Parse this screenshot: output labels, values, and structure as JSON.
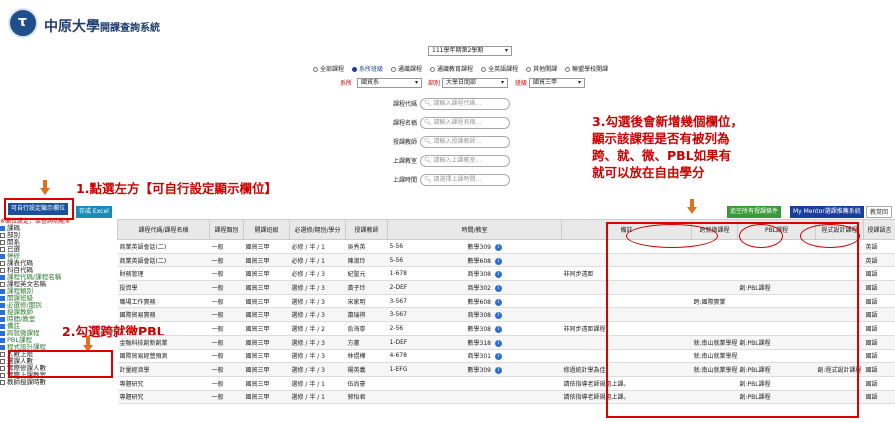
{
  "site": {
    "title_main": "中原大學",
    "title_sub": "開課查詢系統",
    "logo_glyph": "τ"
  },
  "semester": "111學年期第2學期",
  "radios": [
    {
      "label": "全部課程",
      "on": false
    },
    {
      "label": "系所班級",
      "on": true
    },
    {
      "label": "通識課程",
      "on": false
    },
    {
      "label": "通識教育課程",
      "on": false
    },
    {
      "label": "全英語課程",
      "on": false
    },
    {
      "label": "其他開課",
      "on": false
    },
    {
      "label": "聯盟學校開課",
      "on": false
    }
  ],
  "filters": {
    "dept_label": "系所",
    "dept_value": "國貿系",
    "college_label": "部別",
    "college_value": "大學日間部",
    "class_label": "班級",
    "class_value": "國貿三甲"
  },
  "search_fields": [
    {
      "label": "課程代碼",
      "placeholder": "請輸入課程代碼..."
    },
    {
      "label": "課程名稱",
      "placeholder": "請輸入課程名稱..."
    },
    {
      "label": "授課教師",
      "placeholder": "請輸入授課教師..."
    },
    {
      "label": "上課教室",
      "placeholder": "請輸入上課教室..."
    },
    {
      "label": "上課時間",
      "placeholder": "請選擇上課時間..."
    }
  ],
  "annotations": {
    "a1": "1.點選左方【可自行設定顯示欄位】",
    "a2": "2.勾選跨就微PBL",
    "a3_l1": "3.勾選後會新增幾個欄位，",
    "a3_l2": "顯示該課程是否有被列為",
    "a3_l3": "跨、就、微、PBL如果有",
    "a3_l4": "就可以放在自由學分"
  },
  "buttons": {
    "col_setting": "可自行設定顯示欄位",
    "excel": "存成 Excel",
    "add_all": "追空所有授課條件",
    "mentor": "My Mentor選課推薦系統",
    "right_cut": "教覚回"
  },
  "left_note": "※欄位設定，本查詢功能※",
  "left_items": [
    {
      "label": "課碼",
      "on": true,
      "green": false
    },
    {
      "label": "部別",
      "on": false,
      "green": false
    },
    {
      "label": "開系",
      "on": false,
      "green": false
    },
    {
      "label": "已選",
      "on": false,
      "green": false
    },
    {
      "label": "停修",
      "on": true,
      "green": true
    },
    {
      "label": "課表代碼",
      "on": false,
      "green": false
    },
    {
      "label": "科目代碼",
      "on": false,
      "green": false
    },
    {
      "label": "課程代碼/課程名稱",
      "on": true,
      "green": true
    },
    {
      "label": "課程英文名稱",
      "on": false,
      "green": false
    },
    {
      "label": "課程類別",
      "on": true,
      "green": true
    },
    {
      "label": "開課班級",
      "on": true,
      "green": true
    },
    {
      "label": "必選修/期別",
      "on": true,
      "green": true
    },
    {
      "label": "授課教師",
      "on": true,
      "green": true
    },
    {
      "label": "時間/教室",
      "on": true,
      "green": true
    },
    {
      "label": "備註",
      "on": true,
      "green": true
    },
    {
      "label": "跨就微課程",
      "on": true,
      "green": true
    },
    {
      "label": "PBL課程",
      "on": true,
      "green": true
    },
    {
      "label": "程式設計課程",
      "on": true,
      "green": true
    },
    {
      "label": "人數上限",
      "on": false,
      "green": false
    },
    {
      "label": "選課人數",
      "on": false,
      "green": false
    },
    {
      "label": "實際修課人數",
      "on": false,
      "green": false
    },
    {
      "label": "實際上課教室",
      "on": false,
      "green": false
    },
    {
      "label": "教師授課時數",
      "on": false,
      "green": false
    }
  ],
  "table": {
    "headers": [
      "課程代碼/課程名稱",
      "課程類別",
      "開課班級",
      "必選修/期別/學分",
      "授課教師",
      "時間/教室",
      "備註",
      "跨就微課程",
      "PBL課程",
      "程式設計課程",
      "授課語言"
    ],
    "rows": [
      [
        "商業英語會話(二)",
        "一般",
        "國貿三甲",
        "必修 / 半 / 1",
        "吳秀英",
        "5-56",
        "數學309",
        "",
        "",
        "",
        "",
        "英語"
      ],
      [
        "商業英語會話(二)",
        "一般",
        "國貿三甲",
        "必修 / 半 / 1",
        "陳淑玲",
        "5-56",
        "數學608",
        "",
        "",
        "",
        "",
        "英語"
      ],
      [
        "財務管理",
        "一般",
        "國貿三甲",
        "必修 / 半 / 3",
        "紀聖元",
        "1-678",
        "商學308",
        "非同步遠距",
        "",
        "",
        "",
        "國語"
      ],
      [
        "投資學",
        "一般",
        "國貿三甲",
        "選修 / 半 / 3",
        "黃子玲",
        "2-DEF",
        "商學302",
        "",
        "",
        "創:PBL課程",
        "",
        "國語"
      ],
      [
        "職場工作實務",
        "一般",
        "國貿三甲",
        "選修 / 半 / 3",
        "宋家明",
        "3-567",
        "數學608",
        "",
        "跨:國際實業",
        "",
        "",
        "國語"
      ],
      [
        "國際貿易實務",
        "一般",
        "國貿三甲",
        "選修 / 半 / 3",
        "蕭瑞祺",
        "3-567",
        "商學308",
        "",
        "",
        "",
        "",
        "國語"
      ],
      [
        "",
        "一般",
        "國貿三甲",
        "選修 / 半 / 2",
        "俞海寧",
        "2-56",
        "數學308",
        "非同步遠距課程",
        "",
        "",
        "",
        "國語"
      ],
      [
        "金融科技創新創業",
        "一般",
        "國貿三甲",
        "選修 / 半 / 3",
        "方蘆",
        "1-DEF",
        "數學318",
        "",
        "就:南山就業學程",
        "創:PBL課程",
        "",
        "國語"
      ],
      [
        "國際貿易經營預測",
        "一般",
        "國貿三甲",
        "選修 / 半 / 3",
        "林煜樺",
        "4-678",
        "商學301",
        "",
        "就:南山就業學程",
        "",
        "",
        "國語"
      ],
      [
        "計量經濟學",
        "一般",
        "國貿三甲",
        "選修 / 半 / 3",
        "楊英義",
        "1-EFG",
        "數學309",
        "修過統計學為佳",
        "就:南山就業學程",
        "創:PBL課程",
        "創:程式設計課程",
        "國語"
      ],
      [
        "專題研究",
        "一般",
        "國貿三甲",
        "選修 / 半 / 1",
        "伍尚豪",
        "",
        "",
        "請依指導老師規範上課。",
        "",
        "創:PBL課程",
        "",
        "國語"
      ],
      [
        "專題研究",
        "一般",
        "國貿三甲",
        "選修 / 半 / 1",
        "郭怡君",
        "",
        "",
        "請依指導老師規範上課。",
        "",
        "創:PBL課程",
        "",
        "國語"
      ]
    ]
  }
}
